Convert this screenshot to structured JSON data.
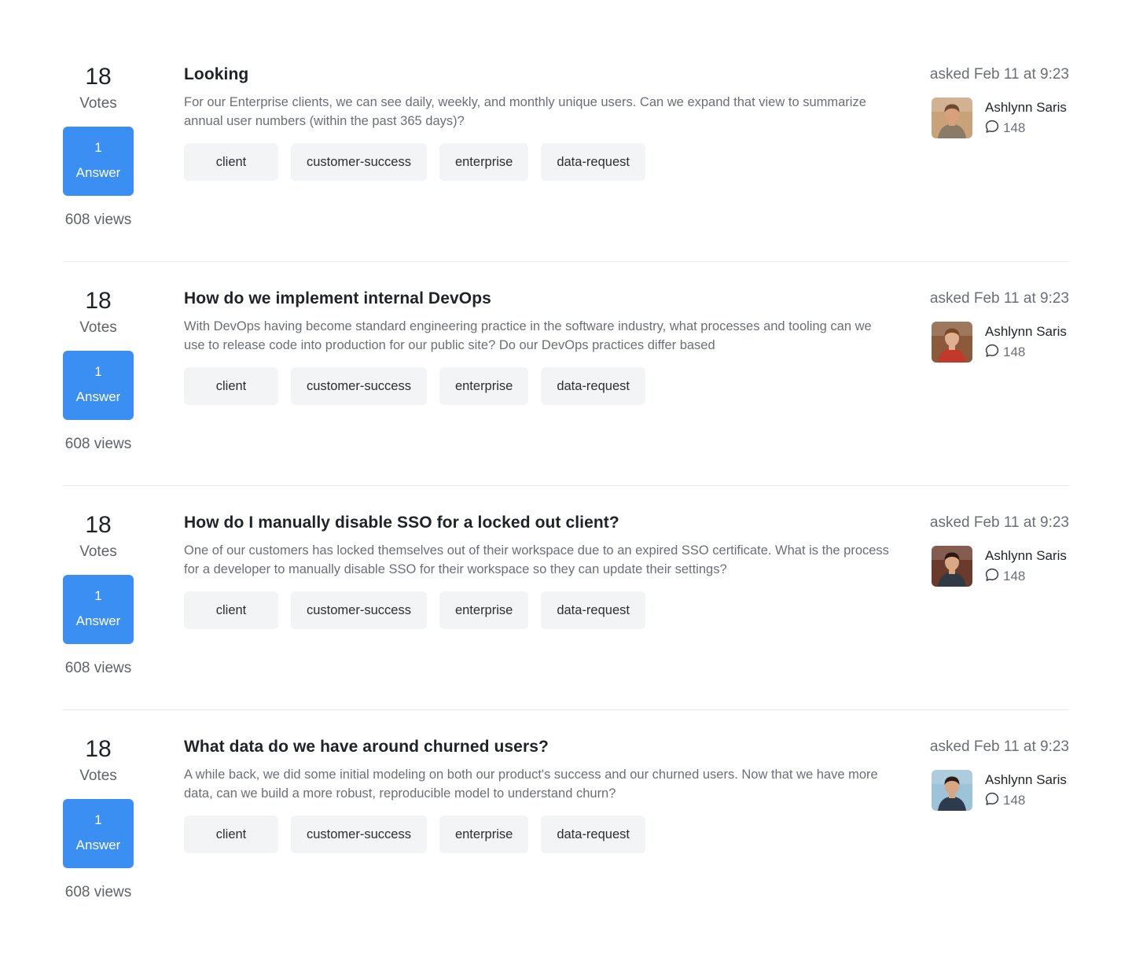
{
  "questions": [
    {
      "votes": "18",
      "votes_label": "Votes",
      "answers": "1",
      "answers_label": "Answer",
      "views": "608 views",
      "title": "Looking",
      "excerpt": "For our Enterprise clients, we can see daily, weekly, and monthly unique users. Can we expand that view to summarize annual user numbers (within the past 365 days)?",
      "tags": [
        "client",
        "customer-success",
        "enterprise",
        "data-request"
      ],
      "asked": "asked Feb 11 at 9:23",
      "author": "Ashlynn Saris",
      "reputation": "148",
      "avatar_colors": {
        "bg": "#c9a27a",
        "skin": "#d8a07c",
        "hair": "#6b4a2f",
        "shirt": "#8a7a68"
      }
    },
    {
      "votes": "18",
      "votes_label": "Votes",
      "answers": "1",
      "answers_label": "Answer",
      "views": "608 views",
      "title": "How do we implement internal DevOps",
      "excerpt": "With DevOps having become standard engineering practice in the software industry, what processes and tooling can we use to release code into production for our public site? Do our DevOps practices differ based",
      "tags": [
        "client",
        "customer-success",
        "enterprise",
        "data-request"
      ],
      "asked": "asked Feb 11 at 9:23",
      "author": "Ashlynn Saris",
      "reputation": "148",
      "avatar_colors": {
        "bg": "#8a5a3a",
        "skin": "#e0b090",
        "hair": "#7a4a28",
        "shirt": "#c0392b"
      }
    },
    {
      "votes": "18",
      "votes_label": "Votes",
      "answers": "1",
      "answers_label": "Answer",
      "views": "608 views",
      "title": "How do I manually disable SSO for a locked out client?",
      "excerpt": "One of our customers has locked themselves out of their workspace due to an expired SSO certificate. What is the process for a developer to manually disable SSO for their workspace so they can update their settings?",
      "tags": [
        "client",
        "customer-success",
        "enterprise",
        "data-request"
      ],
      "asked": "asked Feb 11 at 9:23",
      "author": "Ashlynn Saris",
      "reputation": "148",
      "avatar_colors": {
        "bg": "#6a3a2a",
        "skin": "#d9a887",
        "hair": "#2a1a12",
        "shirt": "#2f3a45"
      }
    },
    {
      "votes": "18",
      "votes_label": "Votes",
      "answers": "1",
      "answers_label": "Answer",
      "views": "608 views",
      "title": "What data do we have around churned users?",
      "excerpt": "A while back, we did some initial modeling on both our product's success and our churned users. Now that we have more data, can we build a more robust, reproducible model to understand churn?",
      "tags": [
        "client",
        "customer-success",
        "enterprise",
        "data-request"
      ],
      "asked": "asked Feb 11 at 9:23",
      "author": "Ashlynn Saris",
      "reputation": "148",
      "avatar_colors": {
        "bg": "#9cc3d8",
        "skin": "#d7a684",
        "hair": "#2b1d14",
        "shirt": "#2e3b4e"
      }
    }
  ],
  "icons": {
    "reputation": "comment-bubble-icon"
  },
  "colors": {
    "accent": "#3b8ff2",
    "tag_bg": "#f3f4f5",
    "muted_text": "#6b6f75"
  }
}
